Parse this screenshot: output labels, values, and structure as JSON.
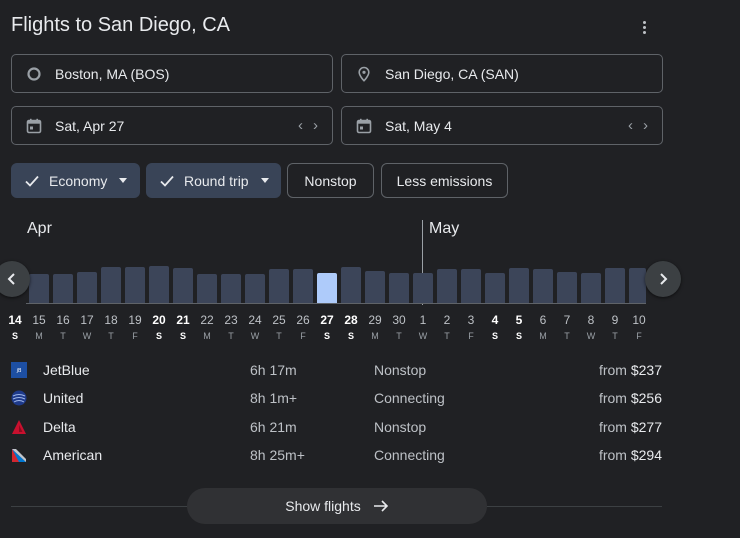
{
  "header": {
    "title": "Flights to San Diego, CA",
    "menu_icon": "more-vert-icon"
  },
  "origin": {
    "value": "Boston, MA (BOS)",
    "icon": "circle-icon"
  },
  "destination": {
    "value": "San Diego, CA (SAN)",
    "icon": "location-pin-icon"
  },
  "depart": {
    "value": "Sat, Apr 27",
    "icon": "calendar-icon"
  },
  "return": {
    "value": "Sat, May 4",
    "icon": "calendar-icon"
  },
  "filters": {
    "class": "Economy",
    "trip_type": "Round trip",
    "nonstop": "Nonstop",
    "emissions": "Less emissions"
  },
  "calendar": {
    "month_1": "Apr",
    "month_2": "May",
    "selected_index": 13,
    "days": [
      {
        "day": "14",
        "dow": "S",
        "bold": true
      },
      {
        "day": "15",
        "dow": "M"
      },
      {
        "day": "16",
        "dow": "T"
      },
      {
        "day": "17",
        "dow": "W"
      },
      {
        "day": "18",
        "dow": "T"
      },
      {
        "day": "19",
        "dow": "F"
      },
      {
        "day": "20",
        "dow": "S",
        "bold": true
      },
      {
        "day": "21",
        "dow": "S",
        "bold": true
      },
      {
        "day": "22",
        "dow": "M"
      },
      {
        "day": "23",
        "dow": "T"
      },
      {
        "day": "24",
        "dow": "W"
      },
      {
        "day": "25",
        "dow": "T"
      },
      {
        "day": "26",
        "dow": "F"
      },
      {
        "day": "27",
        "dow": "S",
        "bold": true
      },
      {
        "day": "28",
        "dow": "S",
        "bold": true
      },
      {
        "day": "29",
        "dow": "M"
      },
      {
        "day": "30",
        "dow": "T"
      },
      {
        "day": "1",
        "dow": "W"
      },
      {
        "day": "2",
        "dow": "T"
      },
      {
        "day": "3",
        "dow": "F"
      },
      {
        "day": "4",
        "dow": "S",
        "bold": true
      },
      {
        "day": "5",
        "dow": "S",
        "bold": true
      },
      {
        "day": "6",
        "dow": "M"
      },
      {
        "day": "7",
        "dow": "T"
      },
      {
        "day": "8",
        "dow": "W"
      },
      {
        "day": "9",
        "dow": "T"
      },
      {
        "day": "10",
        "dow": "F"
      }
    ]
  },
  "flights": [
    {
      "airline": "JetBlue",
      "duration": "6h 17m",
      "stops": "Nonstop",
      "from_label": "from",
      "price": "$237",
      "logo": "jetblue-logo-icon"
    },
    {
      "airline": "United",
      "duration": "8h 1m+",
      "stops": "Connecting",
      "from_label": "from",
      "price": "$256",
      "logo": "united-logo-icon"
    },
    {
      "airline": "Delta",
      "duration": "6h 21m",
      "stops": "Nonstop",
      "from_label": "from",
      "price": "$277",
      "logo": "delta-logo-icon"
    },
    {
      "airline": "American",
      "duration": "8h 25m+",
      "stops": "Connecting",
      "from_label": "from",
      "price": "$294",
      "logo": "american-logo-icon"
    }
  ],
  "show_flights": {
    "label": "Show flights",
    "icon": "arrow-right-icon"
  },
  "colors": {
    "selected_bar": "#aecbfa",
    "bar": "#3c4559",
    "chip_selected": "#394457"
  }
}
